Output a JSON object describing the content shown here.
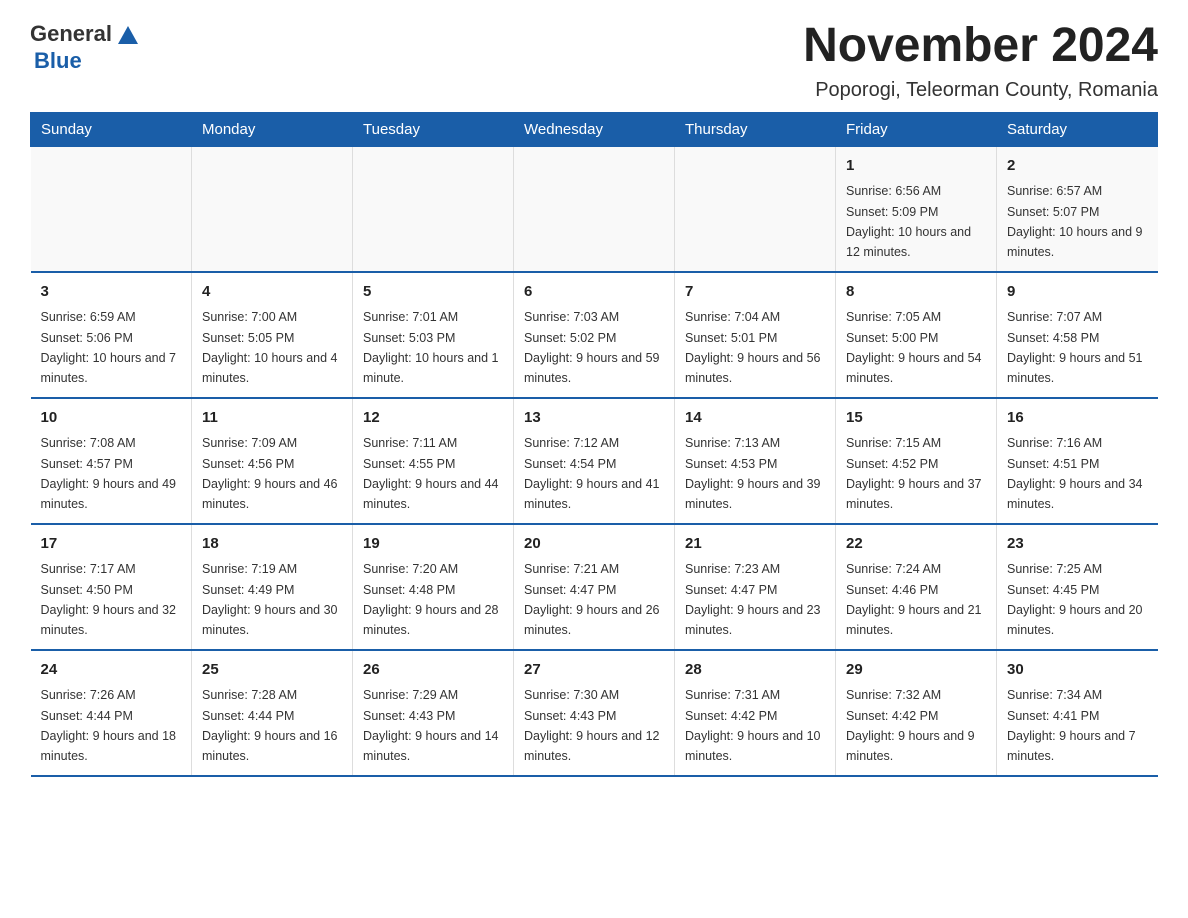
{
  "logo": {
    "text_general": "General",
    "triangle_color": "#1a5ea8",
    "text_blue": "Blue"
  },
  "title": "November 2024",
  "subtitle": "Poporogi, Teleorman County, Romania",
  "days_of_week": [
    "Sunday",
    "Monday",
    "Tuesday",
    "Wednesday",
    "Thursday",
    "Friday",
    "Saturday"
  ],
  "weeks": [
    [
      {
        "day": "",
        "sunrise": "",
        "sunset": "",
        "daylight": ""
      },
      {
        "day": "",
        "sunrise": "",
        "sunset": "",
        "daylight": ""
      },
      {
        "day": "",
        "sunrise": "",
        "sunset": "",
        "daylight": ""
      },
      {
        "day": "",
        "sunrise": "",
        "sunset": "",
        "daylight": ""
      },
      {
        "day": "",
        "sunrise": "",
        "sunset": "",
        "daylight": ""
      },
      {
        "day": "1",
        "sunrise": "Sunrise: 6:56 AM",
        "sunset": "Sunset: 5:09 PM",
        "daylight": "Daylight: 10 hours and 12 minutes."
      },
      {
        "day": "2",
        "sunrise": "Sunrise: 6:57 AM",
        "sunset": "Sunset: 5:07 PM",
        "daylight": "Daylight: 10 hours and 9 minutes."
      }
    ],
    [
      {
        "day": "3",
        "sunrise": "Sunrise: 6:59 AM",
        "sunset": "Sunset: 5:06 PM",
        "daylight": "Daylight: 10 hours and 7 minutes."
      },
      {
        "day": "4",
        "sunrise": "Sunrise: 7:00 AM",
        "sunset": "Sunset: 5:05 PM",
        "daylight": "Daylight: 10 hours and 4 minutes."
      },
      {
        "day": "5",
        "sunrise": "Sunrise: 7:01 AM",
        "sunset": "Sunset: 5:03 PM",
        "daylight": "Daylight: 10 hours and 1 minute."
      },
      {
        "day": "6",
        "sunrise": "Sunrise: 7:03 AM",
        "sunset": "Sunset: 5:02 PM",
        "daylight": "Daylight: 9 hours and 59 minutes."
      },
      {
        "day": "7",
        "sunrise": "Sunrise: 7:04 AM",
        "sunset": "Sunset: 5:01 PM",
        "daylight": "Daylight: 9 hours and 56 minutes."
      },
      {
        "day": "8",
        "sunrise": "Sunrise: 7:05 AM",
        "sunset": "Sunset: 5:00 PM",
        "daylight": "Daylight: 9 hours and 54 minutes."
      },
      {
        "day": "9",
        "sunrise": "Sunrise: 7:07 AM",
        "sunset": "Sunset: 4:58 PM",
        "daylight": "Daylight: 9 hours and 51 minutes."
      }
    ],
    [
      {
        "day": "10",
        "sunrise": "Sunrise: 7:08 AM",
        "sunset": "Sunset: 4:57 PM",
        "daylight": "Daylight: 9 hours and 49 minutes."
      },
      {
        "day": "11",
        "sunrise": "Sunrise: 7:09 AM",
        "sunset": "Sunset: 4:56 PM",
        "daylight": "Daylight: 9 hours and 46 minutes."
      },
      {
        "day": "12",
        "sunrise": "Sunrise: 7:11 AM",
        "sunset": "Sunset: 4:55 PM",
        "daylight": "Daylight: 9 hours and 44 minutes."
      },
      {
        "day": "13",
        "sunrise": "Sunrise: 7:12 AM",
        "sunset": "Sunset: 4:54 PM",
        "daylight": "Daylight: 9 hours and 41 minutes."
      },
      {
        "day": "14",
        "sunrise": "Sunrise: 7:13 AM",
        "sunset": "Sunset: 4:53 PM",
        "daylight": "Daylight: 9 hours and 39 minutes."
      },
      {
        "day": "15",
        "sunrise": "Sunrise: 7:15 AM",
        "sunset": "Sunset: 4:52 PM",
        "daylight": "Daylight: 9 hours and 37 minutes."
      },
      {
        "day": "16",
        "sunrise": "Sunrise: 7:16 AM",
        "sunset": "Sunset: 4:51 PM",
        "daylight": "Daylight: 9 hours and 34 minutes."
      }
    ],
    [
      {
        "day": "17",
        "sunrise": "Sunrise: 7:17 AM",
        "sunset": "Sunset: 4:50 PM",
        "daylight": "Daylight: 9 hours and 32 minutes."
      },
      {
        "day": "18",
        "sunrise": "Sunrise: 7:19 AM",
        "sunset": "Sunset: 4:49 PM",
        "daylight": "Daylight: 9 hours and 30 minutes."
      },
      {
        "day": "19",
        "sunrise": "Sunrise: 7:20 AM",
        "sunset": "Sunset: 4:48 PM",
        "daylight": "Daylight: 9 hours and 28 minutes."
      },
      {
        "day": "20",
        "sunrise": "Sunrise: 7:21 AM",
        "sunset": "Sunset: 4:47 PM",
        "daylight": "Daylight: 9 hours and 26 minutes."
      },
      {
        "day": "21",
        "sunrise": "Sunrise: 7:23 AM",
        "sunset": "Sunset: 4:47 PM",
        "daylight": "Daylight: 9 hours and 23 minutes."
      },
      {
        "day": "22",
        "sunrise": "Sunrise: 7:24 AM",
        "sunset": "Sunset: 4:46 PM",
        "daylight": "Daylight: 9 hours and 21 minutes."
      },
      {
        "day": "23",
        "sunrise": "Sunrise: 7:25 AM",
        "sunset": "Sunset: 4:45 PM",
        "daylight": "Daylight: 9 hours and 20 minutes."
      }
    ],
    [
      {
        "day": "24",
        "sunrise": "Sunrise: 7:26 AM",
        "sunset": "Sunset: 4:44 PM",
        "daylight": "Daylight: 9 hours and 18 minutes."
      },
      {
        "day": "25",
        "sunrise": "Sunrise: 7:28 AM",
        "sunset": "Sunset: 4:44 PM",
        "daylight": "Daylight: 9 hours and 16 minutes."
      },
      {
        "day": "26",
        "sunrise": "Sunrise: 7:29 AM",
        "sunset": "Sunset: 4:43 PM",
        "daylight": "Daylight: 9 hours and 14 minutes."
      },
      {
        "day": "27",
        "sunrise": "Sunrise: 7:30 AM",
        "sunset": "Sunset: 4:43 PM",
        "daylight": "Daylight: 9 hours and 12 minutes."
      },
      {
        "day": "28",
        "sunrise": "Sunrise: 7:31 AM",
        "sunset": "Sunset: 4:42 PM",
        "daylight": "Daylight: 9 hours and 10 minutes."
      },
      {
        "day": "29",
        "sunrise": "Sunrise: 7:32 AM",
        "sunset": "Sunset: 4:42 PM",
        "daylight": "Daylight: 9 hours and 9 minutes."
      },
      {
        "day": "30",
        "sunrise": "Sunrise: 7:34 AM",
        "sunset": "Sunset: 4:41 PM",
        "daylight": "Daylight: 9 hours and 7 minutes."
      }
    ]
  ]
}
